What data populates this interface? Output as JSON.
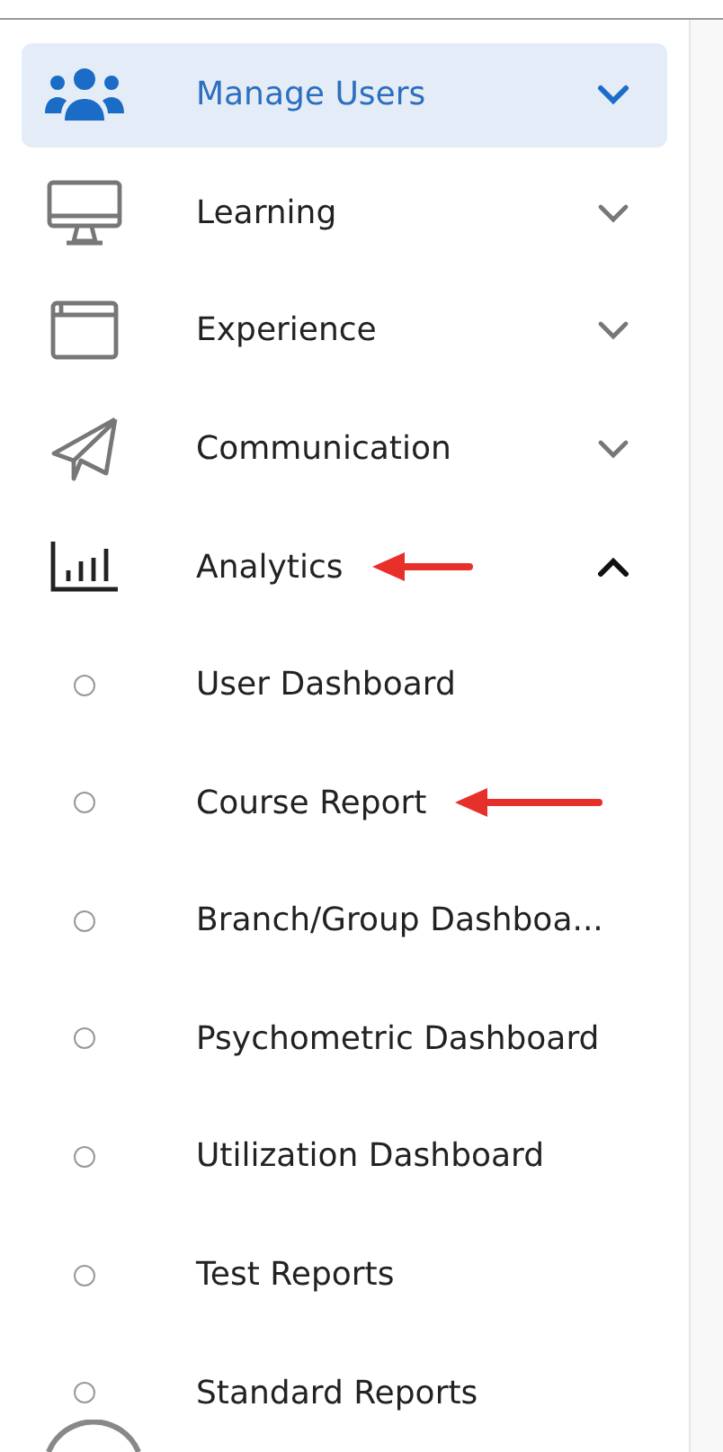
{
  "menu": [
    {
      "label": "Manage Users",
      "kind": "users",
      "selected": true,
      "expanded": false,
      "annotated": false
    },
    {
      "label": "Learning",
      "kind": "monitor",
      "selected": false,
      "expanded": false,
      "annotated": false
    },
    {
      "label": "Experience",
      "kind": "window",
      "selected": false,
      "expanded": false,
      "annotated": false
    },
    {
      "label": "Communication",
      "kind": "plane",
      "selected": false,
      "expanded": false,
      "annotated": false
    },
    {
      "label": "Analytics",
      "kind": "chart",
      "selected": false,
      "expanded": true,
      "annotated": true,
      "children": [
        {
          "label": "User Dashboard",
          "selected": false,
          "annotated": false
        },
        {
          "label": "Course Report",
          "selected": false,
          "annotated": true
        },
        {
          "label": "Branch/Group Dashboa...",
          "selected": false,
          "annotated": false
        },
        {
          "label": "Psychometric Dashboard",
          "selected": false,
          "annotated": false
        },
        {
          "label": "Utilization Dashboard",
          "selected": false,
          "annotated": false
        },
        {
          "label": "Test Reports",
          "selected": false,
          "annotated": false
        },
        {
          "label": "Standard Reports",
          "selected": false,
          "annotated": false
        }
      ]
    }
  ]
}
